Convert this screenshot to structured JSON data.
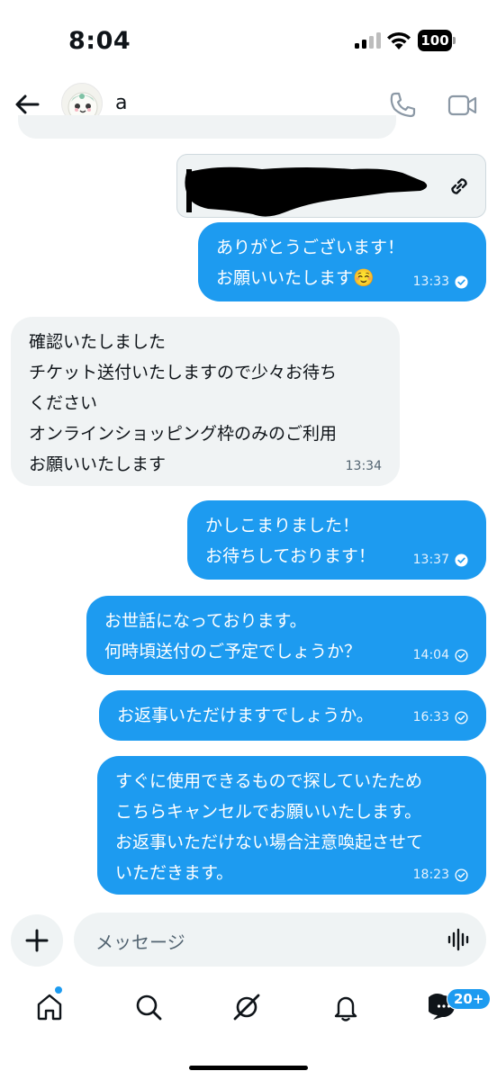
{
  "status_bar": {
    "time": "8:04",
    "battery": "100"
  },
  "header": {
    "contact_name": "a"
  },
  "messages": [
    {
      "direction": "out",
      "text": "ありがとうございます！\nお願いいたします☺️",
      "time": "13:33",
      "status": "read"
    },
    {
      "direction": "in",
      "text": "確認いたしました\nチケット送付いたしますので少々お待ち\nください\nオンラインショッピング枠のみのご利用\nお願いいたします",
      "time": "13:34"
    },
    {
      "direction": "out",
      "text": "かしこまりました！\nお待ちしております！",
      "time": "13:37",
      "status": "read"
    },
    {
      "direction": "out",
      "text": "お世話になっております。\n何時頃送付のご予定でしょうか？",
      "time": "14:04",
      "status": "sent"
    },
    {
      "direction": "out",
      "text": "お返事いただけますでしょうか。",
      "time": "16:33",
      "status": "sent"
    },
    {
      "direction": "out",
      "text": "すぐに使用できるもので探していたため\nこちらキャンセルでお願いいたします。\nお返事いただけない場合注意喚起させて\nいただきます。",
      "time": "18:23",
      "status": "sent"
    }
  ],
  "composer": {
    "placeholder": "メッセージ"
  },
  "bottom_nav": {
    "items": [
      "home-icon",
      "search-icon",
      "grok-icon",
      "notifications-icon",
      "messages-icon"
    ],
    "messages_badge": "20+"
  },
  "colors": {
    "accent": "#1d9bf0",
    "incoming_bubble": "#f0f3f4"
  }
}
